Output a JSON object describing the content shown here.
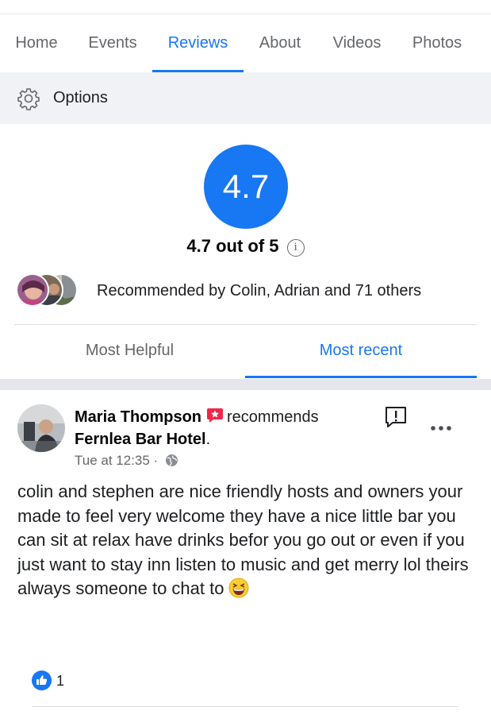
{
  "tabs": [
    {
      "label": "Home",
      "active": false
    },
    {
      "label": "Events",
      "active": false
    },
    {
      "label": "Reviews",
      "active": true
    },
    {
      "label": "About",
      "active": false
    },
    {
      "label": "Videos",
      "active": false
    },
    {
      "label": "Photos",
      "active": false
    }
  ],
  "options": {
    "label": "Options",
    "icon": "gear-icon"
  },
  "rating": {
    "score": "4.7",
    "summary": "4.7 out of 5",
    "info_icon": "i"
  },
  "recommended": {
    "text": "Recommended by Colin, Adrian and 71 others"
  },
  "sort_tabs": {
    "helpful": "Most Helpful",
    "recent": "Most recent",
    "active": "recent"
  },
  "review": {
    "reviewer": "Maria Thompson",
    "verb": "recommends",
    "business": "Fernlea Bar Hotel",
    "business_suffix": ".",
    "time": "Tue at 12:35",
    "separator": " · ",
    "audience_icon": "globe-icon",
    "text": "colin and stephen  are nice friendly hosts and owners  your made to feel very welcome  they have a nice little bar you can sit at  relax  have drinks befor you go out or even if you just want to stay inn listen to music  and get merry lol  theirs always someone to chat to",
    "emoji": "grinning-squinting-face",
    "like_count": "1"
  },
  "colors": {
    "accent": "#1877f2",
    "muted": "#65676b",
    "options_bg": "#f0f2f5",
    "recommend_badge": "#f02849"
  }
}
